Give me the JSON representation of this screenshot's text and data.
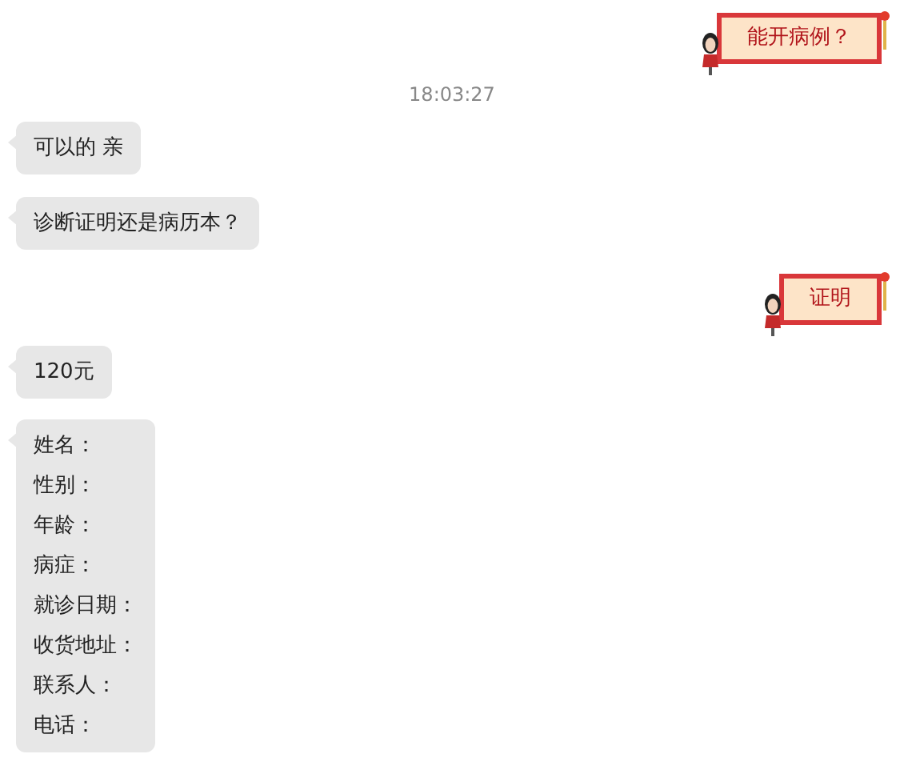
{
  "messages": [
    {
      "kind": "sent",
      "text": "能开病例？"
    },
    {
      "kind": "time",
      "text": "18:03:27"
    },
    {
      "kind": "received",
      "lines": [
        "可以的 亲"
      ]
    },
    {
      "kind": "received",
      "lines": [
        "诊断证明还是病历本？"
      ]
    },
    {
      "kind": "sent",
      "text": "证明"
    },
    {
      "kind": "received",
      "lines": [
        "120元"
      ]
    },
    {
      "kind": "received",
      "lines": [
        "姓名：",
        "性别：",
        "年龄：",
        "病症：",
        "就诊日期：",
        "收货地址：",
        "联系人：",
        "电话："
      ]
    }
  ]
}
